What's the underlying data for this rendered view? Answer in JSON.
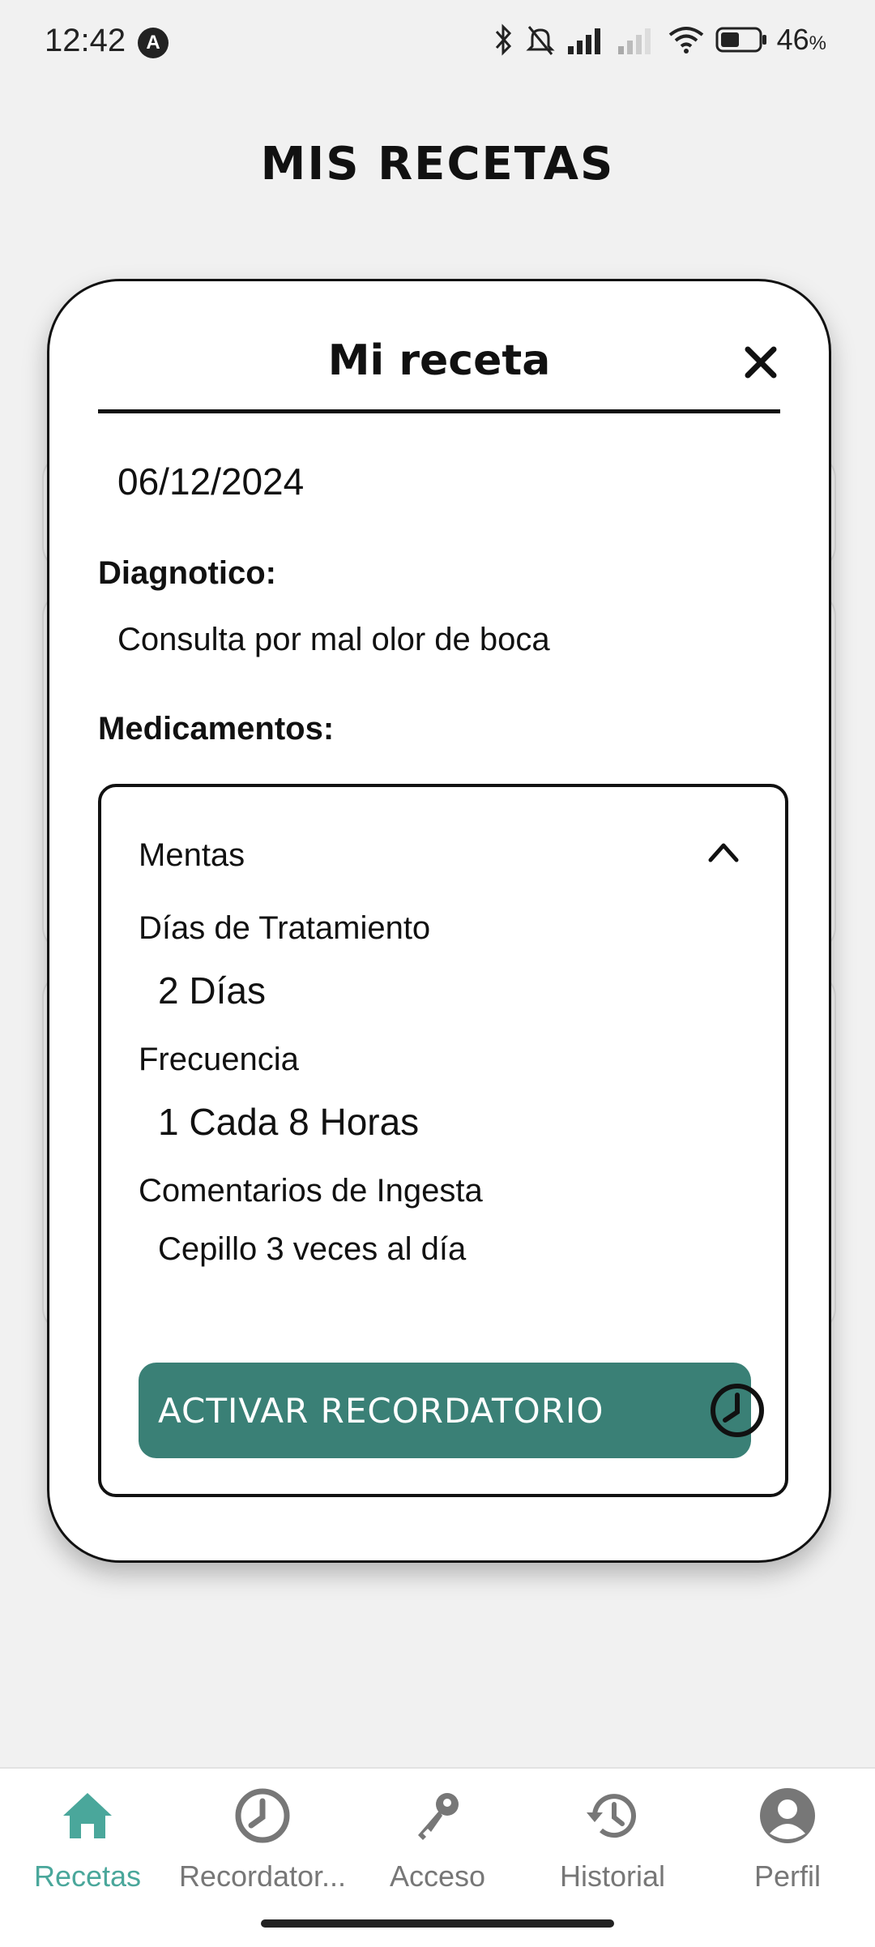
{
  "status_bar": {
    "time": "12:42",
    "battery_pct": "46",
    "battery_unit": "%"
  },
  "page": {
    "title": "MIS RECETAS"
  },
  "modal": {
    "title": "Mi receta",
    "date": "06/12/2024",
    "diagnosis_label": "Diagnotico:",
    "diagnosis_value": "Consulta por mal olor de boca",
    "medications_label": "Medicamentos:",
    "medication": {
      "name": "Mentas",
      "days_label": "Días de Tratamiento",
      "days_value": "2 Días",
      "frequency_label": "Frecuencia",
      "frequency_value": "1 Cada 8 Horas",
      "comments_label": "Comentarios de Ingesta",
      "comments_value": "Cepillo 3 veces al día"
    },
    "reminder_button": "ACTIVAR RECORDATORIO"
  },
  "bottom_nav": {
    "items": [
      {
        "label": "Recetas",
        "icon": "home-icon",
        "active": true
      },
      {
        "label": "Recordator...",
        "icon": "clock-icon",
        "active": false
      },
      {
        "label": "Acceso",
        "icon": "key-icon",
        "active": false
      },
      {
        "label": "Historial",
        "icon": "history-icon",
        "active": false
      },
      {
        "label": "Perfil",
        "icon": "profile-icon",
        "active": false
      }
    ]
  },
  "colors": {
    "accent": "#3a8076",
    "active_nav": "#4aa79b",
    "background": "#f1f1f1"
  }
}
